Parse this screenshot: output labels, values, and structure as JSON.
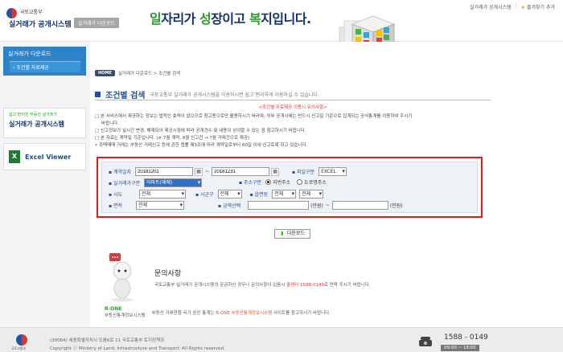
{
  "header": {
    "ministry": "국토교통부",
    "system_title": "실거래가 공개시스템",
    "section_tag": "실거래가 다운로드",
    "slogan_pre": "일",
    "slogan_1": "자리가 ",
    "slogan_mid": "성",
    "slogan_2": "장이고 ",
    "slogan_mid2": "복",
    "slogan_3": "지입니다.",
    "top_link_1": "실거래가 공개시스템",
    "top_link_2": "즐겨찾기 추가"
  },
  "sidebar": {
    "title": "실거래가 다운로드",
    "items": [
      {
        "label": "조건별 자료제공"
      }
    ],
    "banner_small": "쉽고 편리한 부동산 실거래가",
    "banner_big": "실거래가 공개시스템",
    "excel_label": "Excel Viewer"
  },
  "breadcrumb": {
    "home": "HOME",
    "path": "실거래가 다운로드 > 조건별 검색"
  },
  "page": {
    "title": "조건별 검색",
    "desc": "국토교통부 실거래가 공개시스템을 이용하시면 쉽고 편리하게 이용하실 수 있습니다.",
    "notice_title": "<조건별 자료제공 이용시 유의사항>",
    "notes": [
      "□ 본 서비스에서 제공하는 정보는 법적인 효력이 없으므로 참고용으로만 활용하시기 바라며, 외부 공개시에는 반드시 신고일 기준으로 집계되는 공식통계를 이용하여 주시기",
      "바랍니다.",
      "□ 신고정보가 실시간 변경, 해제되어 제공시점에 따라 공개건수 및 내용이 상이할 수 있는 점 참고하시기 바랍니다.",
      "□ 본 자료는 계약일 기준입니다. (※ 7월 계약, 8월 신고건 → 7월 거래건으로 제공)",
      "• 주택매매 거래는 부동산 거래신고 등에 관한 법률 제3조에 따라 계약일로부터 60일 이내 신고토록 하고 있습니다."
    ]
  },
  "form": {
    "contract_date_label": "계약일자",
    "date_from": "20181201",
    "date_sep": "~",
    "date_to": "20181231",
    "file_type_label": "파일구분",
    "file_type": "EXCEL",
    "type_label": "실거래가구분",
    "type_value": "아파트(매매)",
    "addr_label": "주소구분",
    "addr_opt1": "지번주소",
    "addr_opt2": "도로명주소",
    "sido_label": "시도",
    "sido_value": "전체",
    "sigungu_label": "시군구",
    "sigungu_value": "전체",
    "dong_label": "읍면동",
    "dong_value": "전체",
    "dong_value2": "전체",
    "area_label": "면적",
    "area_value": "전체",
    "price_label": "금액선택",
    "price_unit_1": "(만원)",
    "price_sep": "~",
    "price_unit_2": "(만원)",
    "download_btn": "다운로드"
  },
  "inquiry": {
    "title": "문의사항",
    "text_1": "국토교통부 실거래가 공개시스템의 궁금하신 경우나 문의사항이 있음시 ",
    "text_hl": "콜센터 1588-0149",
    "text_2": "로 연락 주시기 바랍니다."
  },
  "rone": {
    "logo": "R-ONE",
    "logo_sub": "부동산통계정보시스템",
    "text_1": "부동산 거래현황 국가 승인 통계는 ",
    "text_hl": "R-ONE 부동산통계정보시스템",
    "text_2": " 사이트를 참고하시기 바랍니다."
  },
  "footer": {
    "mark_text": "국토교통부",
    "address": "(30064) 세종특별자치시 도움6로 11 국토교통부 토지정책과",
    "copyright": "Copyright ⓒ Ministry of Land, Infrastructure and Transport. All Rights reserved.",
    "phone": "1588 - 0149",
    "hours": "09:00 ~ 18:00"
  }
}
